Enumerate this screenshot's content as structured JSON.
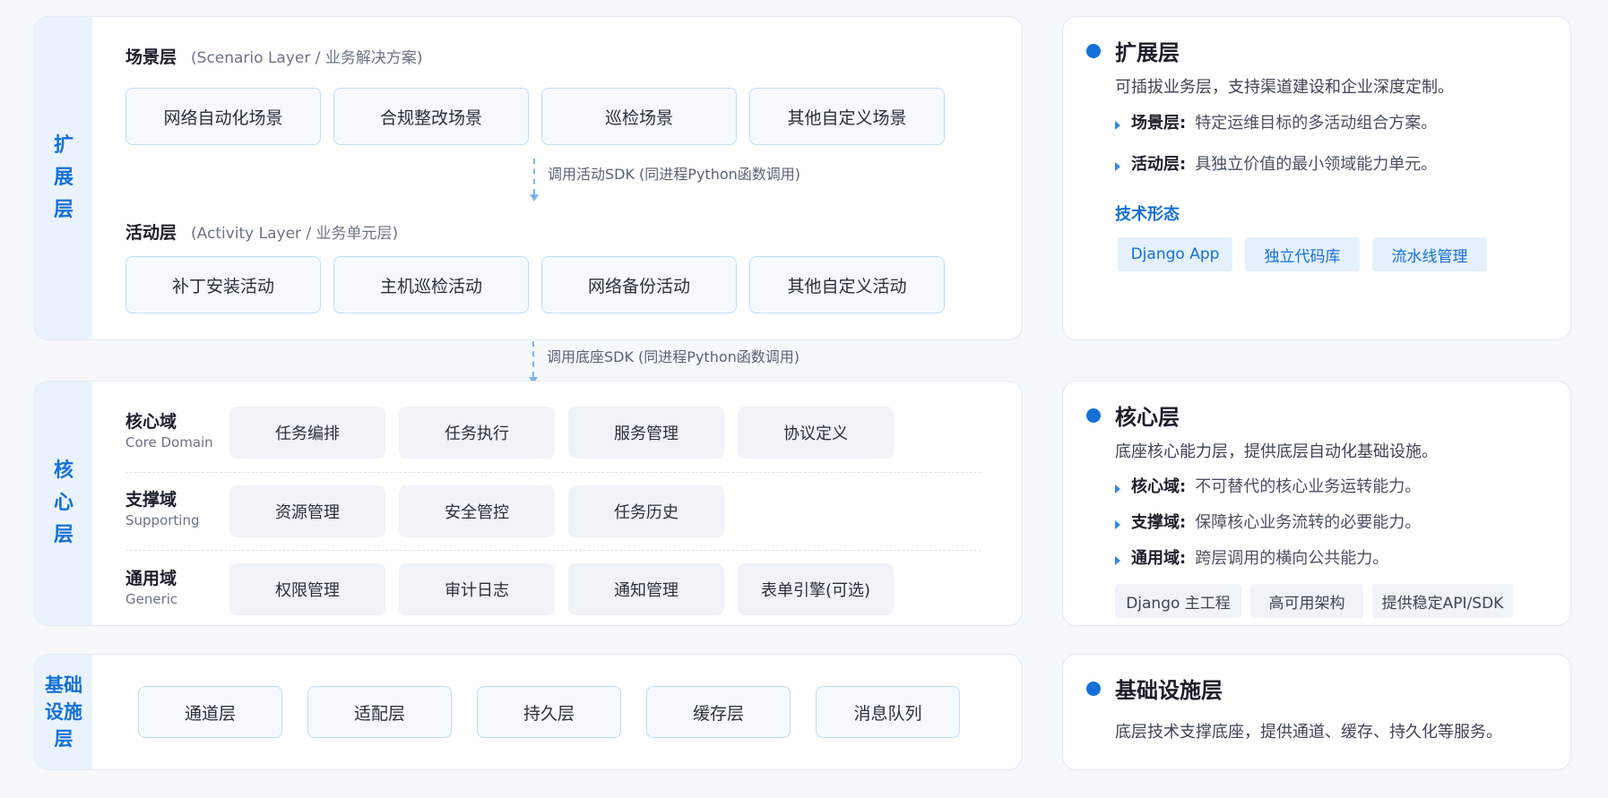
{
  "extension": {
    "strip": [
      "扩",
      "展",
      "层"
    ],
    "scenario": {
      "title": "场景层",
      "subtitle": "(Scenario Layer / 业务解决方案)",
      "items": [
        "网络自动化场景",
        "合规整改场景",
        "巡检场景",
        "其他自定义场景"
      ]
    },
    "arrow_label": "调用活动SDK (同进程Python函数调用)",
    "activity": {
      "title": "活动层",
      "subtitle": "(Activity Layer / 业务单元层)",
      "items": [
        "补丁安装活动",
        "主机巡检活动",
        "网络备份活动",
        "其他自定义活动"
      ]
    }
  },
  "between_arrow_label": "调用底座SDK (同进程Python函数调用)",
  "core": {
    "strip": [
      "核",
      "心",
      "层"
    ],
    "domains": [
      {
        "title": "核心域",
        "subtitle": "Core Domain",
        "items": [
          "任务编排",
          "任务执行",
          "服务管理",
          "协议定义"
        ]
      },
      {
        "title": "支撑域",
        "subtitle": "Supporting",
        "items": [
          "资源管理",
          "安全管控",
          "任务历史"
        ]
      },
      {
        "title": "通用域",
        "subtitle": "Generic",
        "items": [
          "权限管理",
          "审计日志",
          "通知管理",
          "表单引擎(可选)"
        ]
      }
    ]
  },
  "infra": {
    "strip": [
      "基础",
      "设施",
      "层"
    ],
    "items": [
      "通道层",
      "适配层",
      "持久层",
      "缓存层",
      "消息队列"
    ]
  },
  "info": {
    "extension": {
      "title": "扩展层",
      "desc": "可插拔业务层，支持渠道建设和企业深度定制。",
      "bullets": [
        {
          "k": "场景层:",
          "v": "特定运维目标的多活动组合方案。"
        },
        {
          "k": "活动层:",
          "v": "具独立价值的最小领域能力单元。"
        }
      ],
      "tech_label": "技术形态",
      "tags": [
        "Django App",
        "独立代码库",
        "流水线管理"
      ]
    },
    "core": {
      "title": "核心层",
      "desc": "底座核心能力层，提供底层自动化基础设施。",
      "bullets": [
        {
          "k": "核心域:",
          "v": "不可替代的核心业务运转能力。"
        },
        {
          "k": "支撑域:",
          "v": "保障核心业务流转的必要能力。"
        },
        {
          "k": "通用域:",
          "v": "跨层调用的横向公共能力。"
        }
      ],
      "tags": [
        "Django 主工程",
        "高可用架构",
        "提供稳定API/SDK"
      ]
    },
    "infra": {
      "title": "基础设施层",
      "desc": "底层技术支撑底座，提供通道、缓存、持久化等服务。"
    }
  },
  "colors": {
    "accent": "#1570d8",
    "strip_bg": "#eaf3fd",
    "box_border": "#bfdcf6"
  }
}
